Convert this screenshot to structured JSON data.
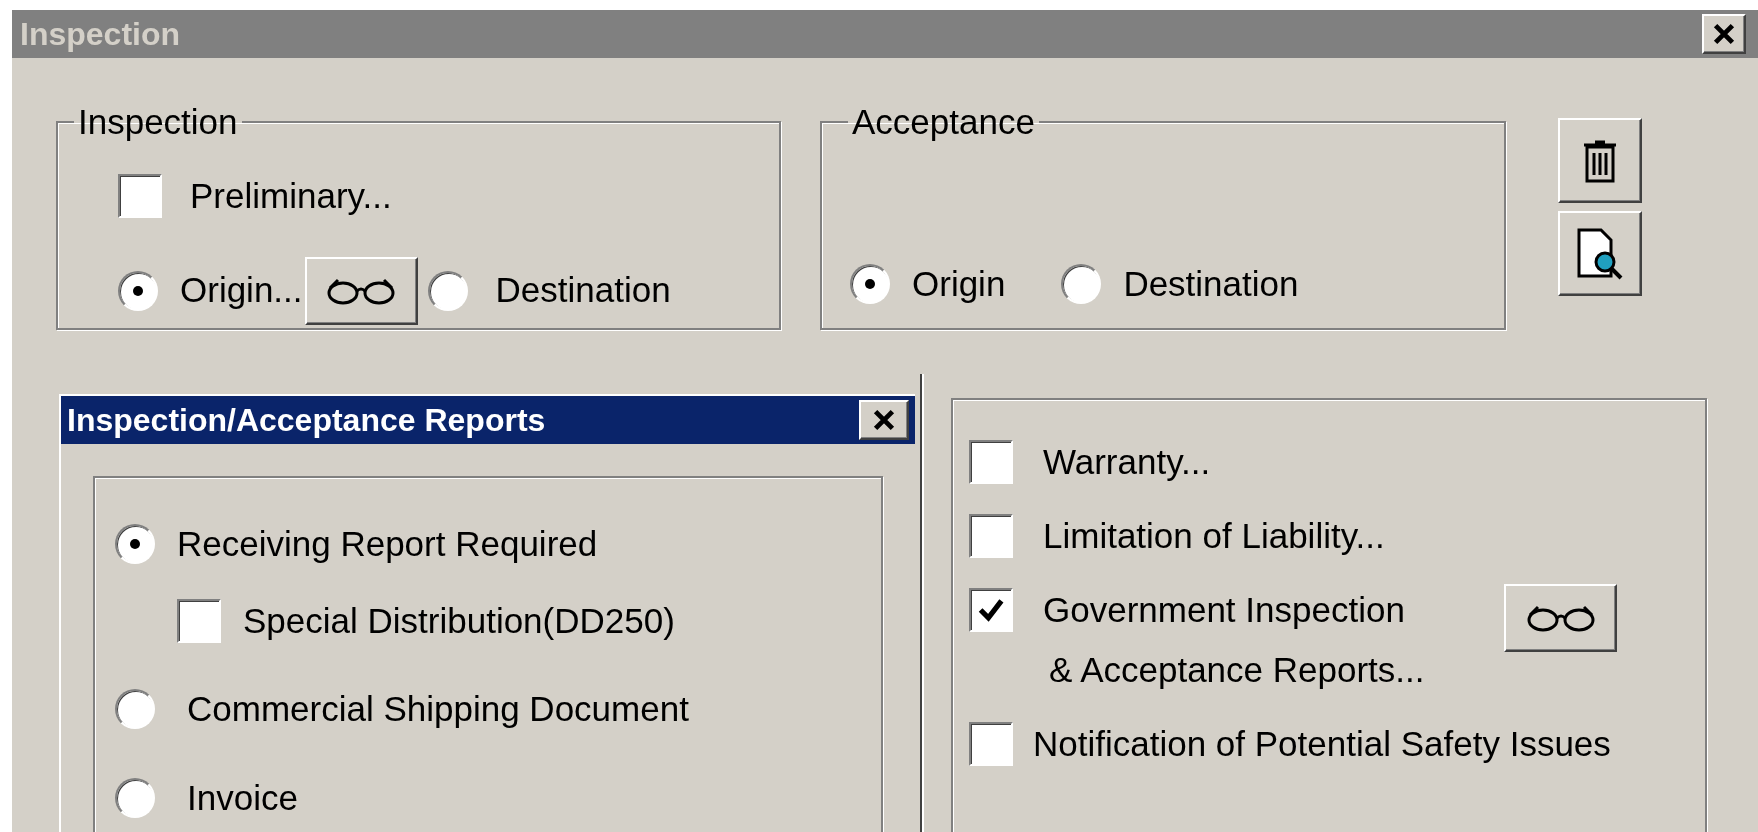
{
  "window": {
    "title": "Inspection"
  },
  "inspection": {
    "title": "Inspection",
    "preliminary": {
      "label": "Preliminary...",
      "checked": false
    },
    "options": [
      {
        "label": "Origin...",
        "selected": true,
        "has_button": true
      },
      {
        "label": "Destination",
        "selected": false,
        "has_button": false
      }
    ]
  },
  "acceptance": {
    "title": "Acceptance",
    "options": [
      {
        "label": "Origin",
        "selected": true
      },
      {
        "label": "Destination",
        "selected": false
      }
    ]
  },
  "reports_window": {
    "title": "Inspection/Acceptance Reports",
    "options": [
      {
        "label": "Receiving Report Required",
        "selected": true,
        "children": [
          {
            "label": "Special Distribution(DD250)",
            "checked": false
          }
        ]
      },
      {
        "label": "Commercial Shipping Document",
        "selected": false
      },
      {
        "label": "Invoice",
        "selected": false
      }
    ]
  },
  "clauses": [
    {
      "lines": [
        "Warranty..."
      ],
      "checked": false,
      "has_button": false
    },
    {
      "lines": [
        "Limitation of Liability..."
      ],
      "checked": false,
      "has_button": false
    },
    {
      "lines": [
        "Government Inspection",
        "& Acceptance Reports..."
      ],
      "checked": true,
      "has_button": true
    },
    {
      "lines": [
        "Notification of Potential Safety Issues"
      ],
      "checked": false,
      "has_button": false
    }
  ]
}
